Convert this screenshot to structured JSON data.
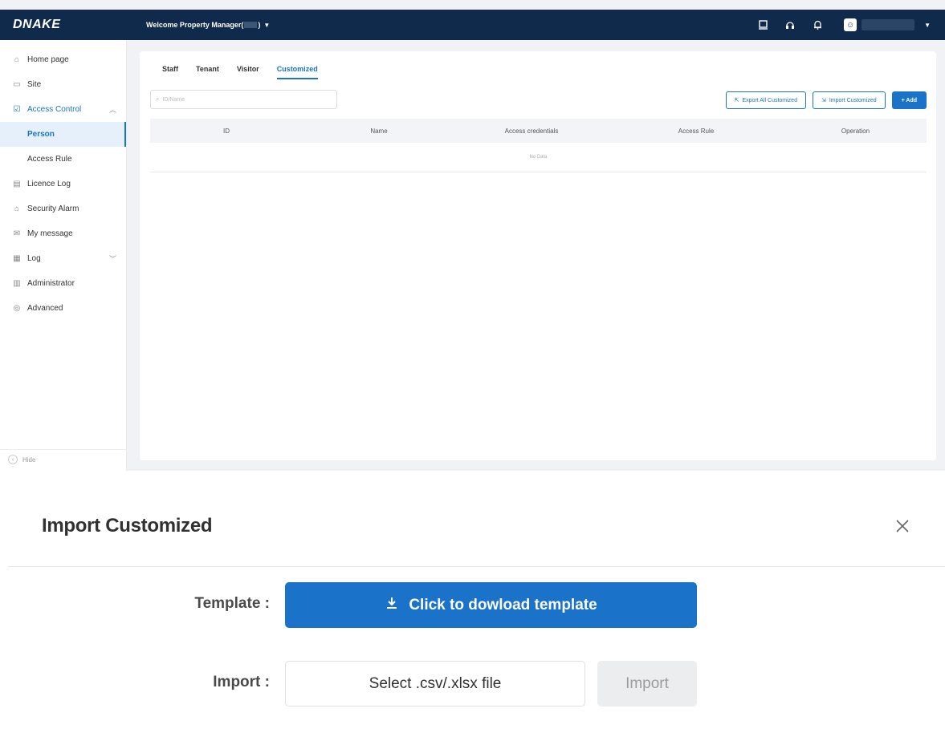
{
  "header": {
    "logo": "DNAKE",
    "welcome": "Welcome  Property Manager(",
    "welcome_suffix": ")"
  },
  "sidebar": {
    "items": [
      {
        "label": "Home page",
        "icon": "home-icon"
      },
      {
        "label": "Site",
        "icon": "folder-icon"
      },
      {
        "label": "Access Control",
        "icon": "shield-check-icon"
      },
      {
        "label": "Licence Log",
        "icon": "license-icon"
      },
      {
        "label": "Security Alarm",
        "icon": "alarm-icon"
      },
      {
        "label": "My message",
        "icon": "mail-icon"
      },
      {
        "label": "Log",
        "icon": "document-icon"
      },
      {
        "label": "Administrator",
        "icon": "admin-icon"
      },
      {
        "label": "Advanced",
        "icon": "settings-circle-icon"
      }
    ],
    "sub_items": [
      "Person",
      "Access Rule"
    ],
    "hide_label": "Hide"
  },
  "tabs": [
    "Staff",
    "Tenant",
    "Visitor",
    "Customized"
  ],
  "search": {
    "placeholder": "ID/Name"
  },
  "actions": {
    "export": "Export All Customized",
    "import": "Import Customized",
    "add": "+ Add"
  },
  "table": {
    "columns": [
      "ID",
      "Name",
      "Access credentials",
      "Access Rule",
      "Operation"
    ],
    "empty": "No Data"
  },
  "dialog": {
    "title": "Import Customized",
    "template_label": "Template :",
    "download_label": "Click to dowload template",
    "import_label": "Import :",
    "file_placeholder": "Select .csv/.xlsx file",
    "import_button": "Import"
  },
  "colors": {
    "topbar": "#0f2a4a",
    "accent": "#1a73c9"
  }
}
